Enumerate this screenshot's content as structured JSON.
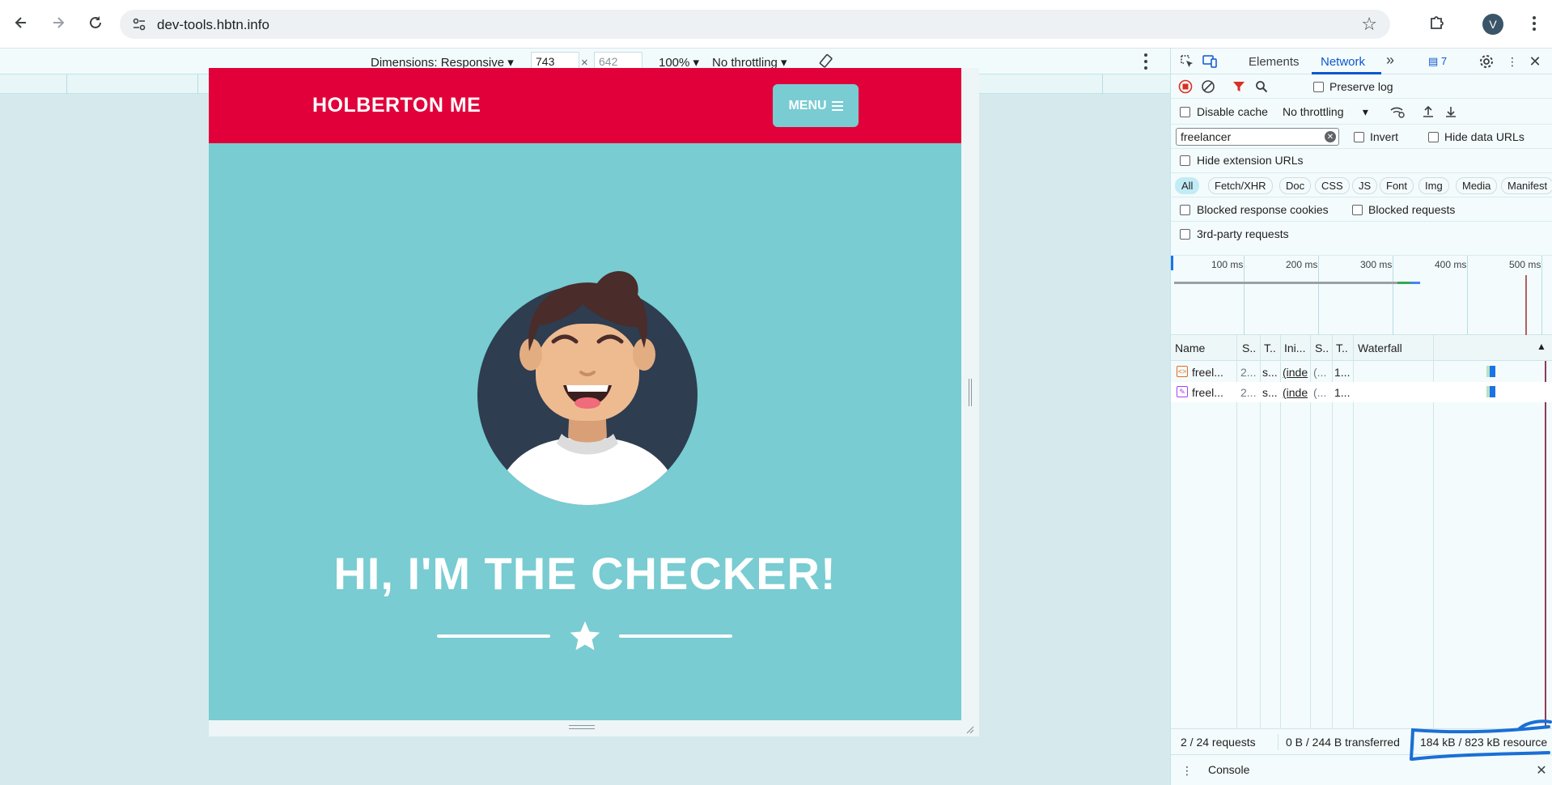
{
  "browser": {
    "url": "dev-tools.hbtn.info",
    "profile_initial": "V",
    "icons": [
      "back-arrow-icon",
      "forward-arrow-icon",
      "reload-icon",
      "site-settings-icon",
      "bookmark-star-icon",
      "extensions-icon",
      "more-vert-icon"
    ]
  },
  "device_toolbar": {
    "dimensions_label": "Dimensions: Responsive",
    "width": "743",
    "height": "642",
    "zoom": "100%",
    "throttling": "No throttling"
  },
  "page": {
    "brand": "HOLBERTON ME",
    "menu_label": "MENU",
    "hero_title": "HI, I'M THE CHECKER!",
    "colors": {
      "header": "#e1003a",
      "body": "#78ccd2",
      "text": "#ffffff"
    }
  },
  "devtools": {
    "tabs": {
      "elements": "Elements",
      "network": "Network",
      "issues_count": "7"
    },
    "toolbar": {
      "preserve_log": "Preserve log",
      "disable_cache": "Disable cache",
      "throttling": "No throttling"
    },
    "filter": {
      "value": "freelancer",
      "invert": "Invert",
      "hide_data_urls": "Hide data URLs",
      "hide_extension_urls": "Hide extension URLs"
    },
    "type_filters": [
      "All",
      "Fetch/XHR",
      "Doc",
      "CSS",
      "JS",
      "Font",
      "Img",
      "Media",
      "Manifest"
    ],
    "blocked_response_cookies": "Blocked response cookies",
    "blocked_requests": "Blocked requests",
    "third_party": "3rd-party requests",
    "overview_ticks": [
      "100 ms",
      "200 ms",
      "300 ms",
      "400 ms",
      "500 ms"
    ],
    "table": {
      "headers": {
        "name": "Name",
        "status": "S..",
        "type": "T..",
        "initiator": "Ini...",
        "size": "S..",
        "time": "T..",
        "waterfall": "Waterfall"
      },
      "rows": [
        {
          "name": "freel...",
          "status": "2...",
          "type": "s...",
          "initiator": "(inde",
          "size": "(...",
          "time": "1..."
        },
        {
          "name": "freel...",
          "status": "2...",
          "type": "s...",
          "initiator": "(inde",
          "size": "(...",
          "time": "1..."
        }
      ]
    },
    "status": {
      "requests": "2 / 24 requests",
      "transferred": "0 B / 244 B transferred",
      "resources": "184 kB / 823 kB resource"
    },
    "drawer": {
      "console": "Console"
    }
  }
}
